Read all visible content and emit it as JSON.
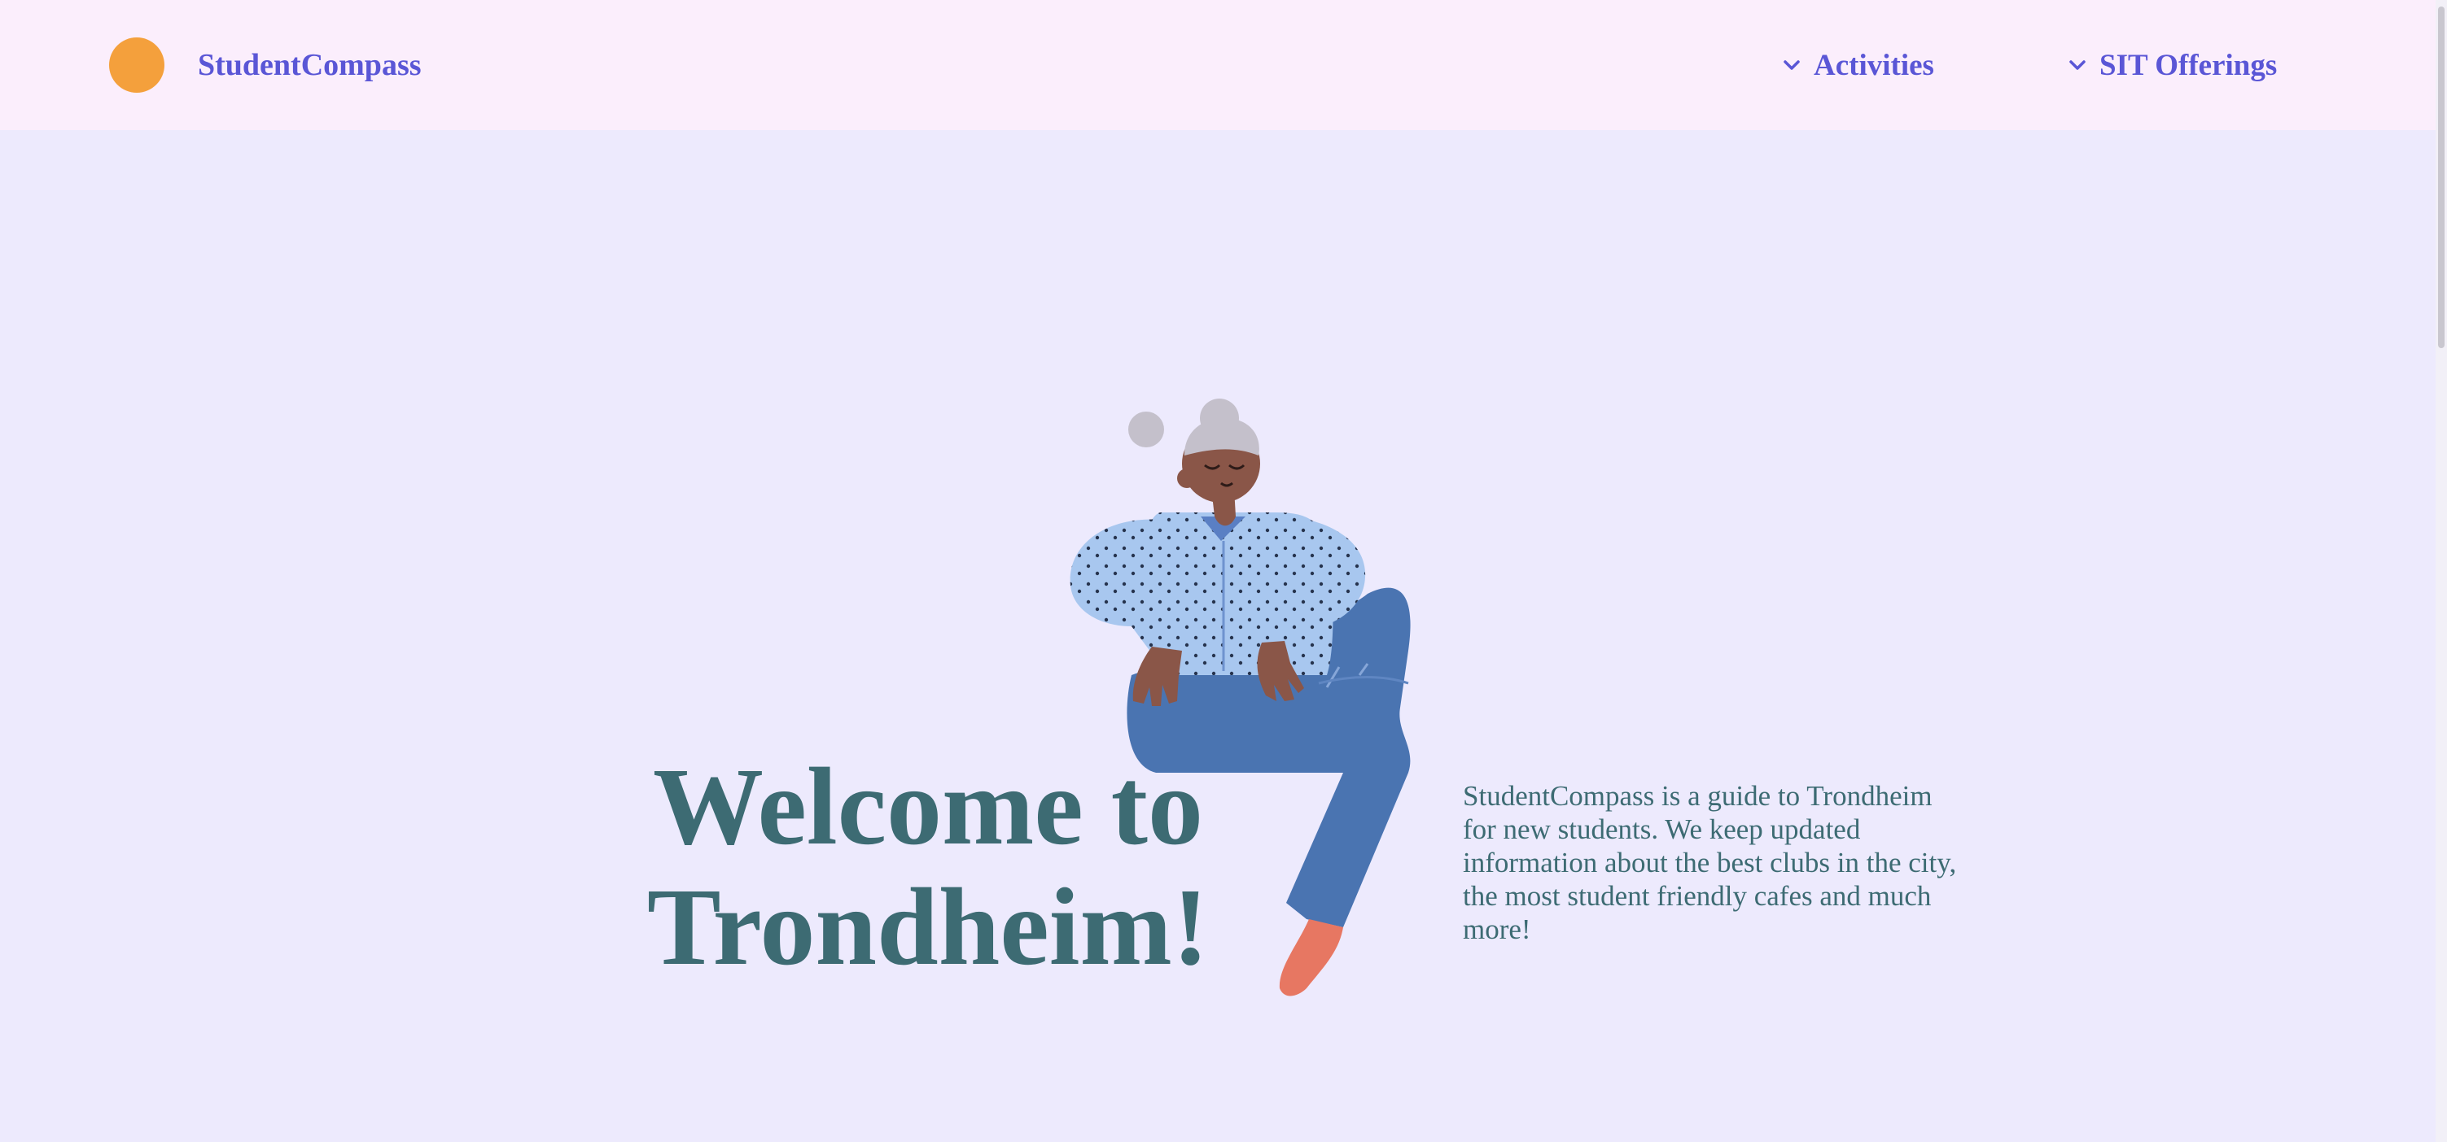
{
  "header": {
    "brand": "StudentCompass",
    "nav": [
      {
        "label": "Activities",
        "icon": "chevron-down-icon"
      },
      {
        "label": "SIT Offerings",
        "icon": "chevron-down-icon"
      }
    ]
  },
  "hero": {
    "title": "Welcome to Trondheim!",
    "description": "StudentCompass is a guide to Trondheim for new students. We keep updated information about the best clubs in the city, the most student friendly cafes and much more!"
  },
  "colors": {
    "background": "#edeafd",
    "header_background": "#fbeefc",
    "brand_accent": "#5a56d6",
    "logo": "#f4a03c",
    "heading_text": "#3d6b73"
  }
}
